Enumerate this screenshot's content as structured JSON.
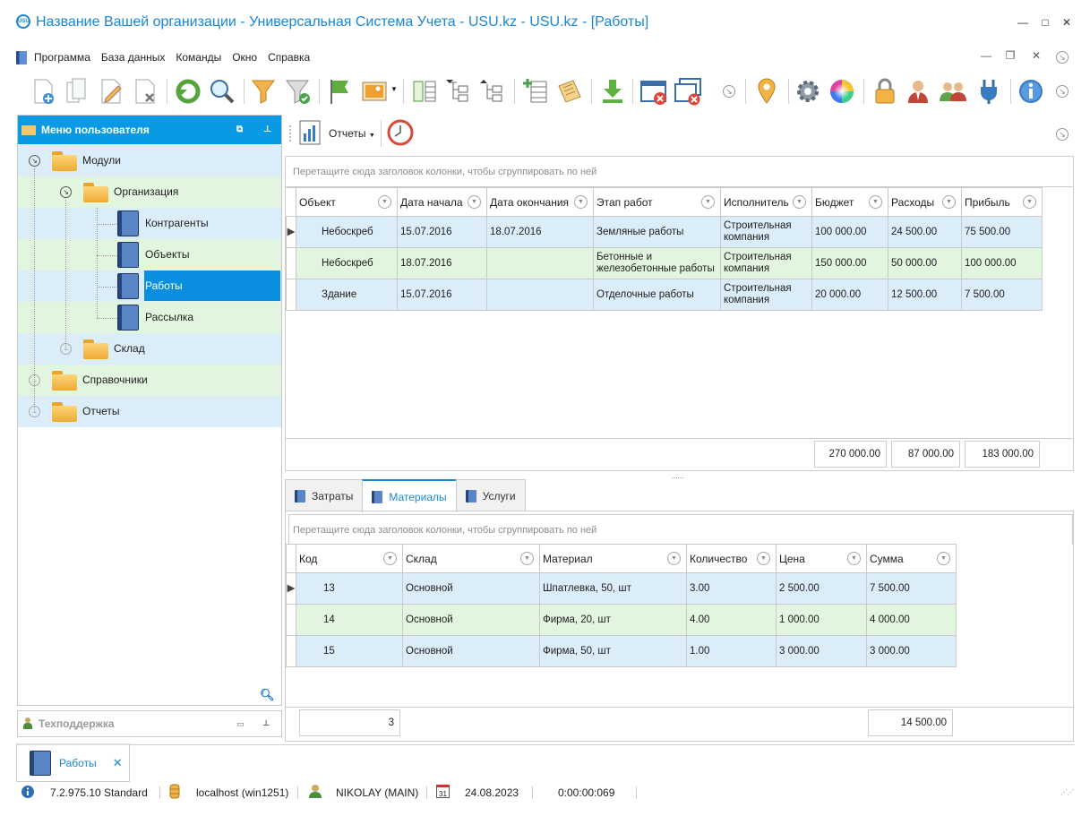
{
  "window": {
    "title": "Название Вашей организации - Универсальная Система Учета - USU.kz - USU.kz - [Работы]",
    "logo_text": "USU"
  },
  "menu": [
    "Программа",
    "База данных",
    "Команды",
    "Окно",
    "Справка"
  ],
  "left_panel": {
    "title": "Меню пользователя",
    "tree": {
      "modules": "Модули",
      "organization": "Организация",
      "contractors": "Контрагенты",
      "objects": "Объекты",
      "works": "Работы",
      "mailing": "Рассылка",
      "warehouse": "Склад",
      "directories": "Справочники",
      "reports": "Отчеты"
    },
    "support": "Техподдержка"
  },
  "subtoolbar": {
    "reports_label": "Отчеты"
  },
  "upper_grid": {
    "group_hint": "Перетащите сюда заголовок колонки, чтобы сгруппировать по ней",
    "columns": [
      "Объект",
      "Дата начала",
      "Дата окончания",
      "Этап работ",
      "Исполнитель",
      "Бюджет",
      "Расходы",
      "Прибыль"
    ],
    "rows": [
      [
        "Небоскреб",
        "15.07.2016",
        "18.07.2016",
        "Земляные работы",
        "Строительная компания",
        "100 000.00",
        "24 500.00",
        "75 500.00"
      ],
      [
        "Небоскреб",
        "18.07.2016",
        "",
        "Бетонные и железобетонные работы",
        "Строительная компания",
        "150 000.00",
        "50 000.00",
        "100 000.00"
      ],
      [
        "Здание",
        "15.07.2016",
        "",
        "Отделочные работы",
        "Строительная компания",
        "20 000.00",
        "12 500.00",
        "7 500.00"
      ]
    ],
    "totals": {
      "budget": "270 000.00",
      "expenses": "87 000.00",
      "profit": "183 000.00"
    }
  },
  "tabs": [
    "Затраты",
    "Материалы",
    "Услуги"
  ],
  "active_tab": "Материалы",
  "lower_grid": {
    "group_hint": "Перетащите сюда заголовок колонки, чтобы сгруппировать по ней",
    "columns": [
      "Код",
      "Склад",
      "Материал",
      "Количество",
      "Цена",
      "Сумма"
    ],
    "rows": [
      [
        "13",
        "Основной",
        "Шпатлевка, 50, шт",
        "3.00",
        "2 500.00",
        "7 500.00"
      ],
      [
        "14",
        "Основной",
        "Фирма, 20, шт",
        "4.00",
        "1 000.00",
        "4 000.00"
      ],
      [
        "15",
        "Основной",
        "Фирма, 50, шт",
        "1.00",
        "3 000.00",
        "3 000.00"
      ]
    ],
    "totals": {
      "count": "3",
      "sum": "14 500.00"
    }
  },
  "doc_tab": {
    "label": "Работы"
  },
  "status": {
    "version": "7.2.975.10 Standard",
    "server": "localhost (win1251)",
    "user": "NIKOLAY (MAIN)",
    "date": "24.08.2023",
    "timer": "0:00:00:069",
    "calendar_day": "31"
  },
  "colors": {
    "accent": "#1a86d8",
    "header_blue": "#0a9ae4",
    "row_blue": "#dcedfa",
    "row_green": "#e2f5df"
  }
}
